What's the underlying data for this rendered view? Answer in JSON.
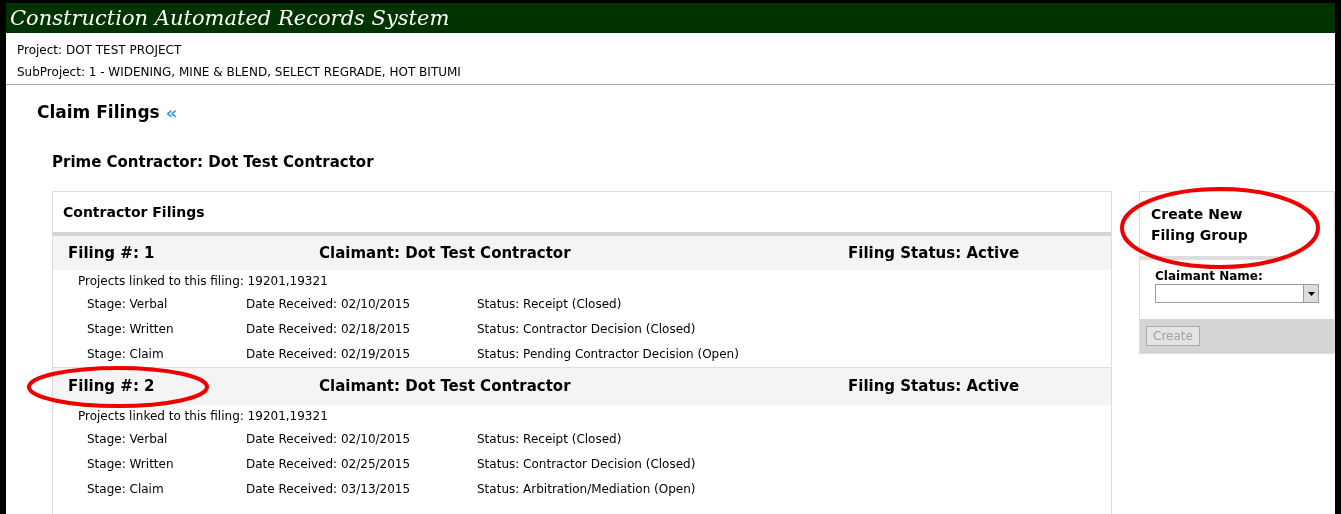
{
  "app_title": "Construction Automated Records System",
  "project": "Project: DOT TEST PROJECT",
  "subproject": "SubProject: 1 - WIDENING, MINE & BLEND, SELECT REGRADE, HOT BITUMI",
  "page_title": "Claim Filings",
  "collapse_glyph": "«",
  "prime_contractor": "Prime Contractor: Dot Test Contractor",
  "filings_panel": {
    "title": "Contractor Filings",
    "filings": [
      {
        "number": "Filing #: 1",
        "claimant": "Claimant: Dot Test Contractor",
        "status": "Filing Status: Active",
        "circled": false,
        "projects": "Projects linked to this filing: 19201,19321",
        "stages": [
          {
            "stage": "Stage: Verbal",
            "date": "Date Received: 02/10/2015",
            "status": "Status: Receipt (Closed)"
          },
          {
            "stage": "Stage: Written",
            "date": "Date Received: 02/18/2015",
            "status": "Status: Contractor Decision (Closed)"
          },
          {
            "stage": "Stage: Claim",
            "date": "Date Received: 02/19/2015",
            "status": "Status: Pending Contractor Decision (Open)"
          }
        ]
      },
      {
        "number": "Filing #: 2",
        "claimant": "Claimant: Dot Test Contractor",
        "status": "Filing Status: Active",
        "circled": true,
        "projects": "Projects linked to this filing: 19201,19321",
        "stages": [
          {
            "stage": "Stage: Verbal",
            "date": "Date Received: 02/10/2015",
            "status": "Status: Receipt (Closed)"
          },
          {
            "stage": "Stage: Written",
            "date": "Date Received: 02/25/2015",
            "status": "Status: Contractor Decision (Closed)"
          },
          {
            "stage": "Stage: Claim",
            "date": "Date Received: 03/13/2015",
            "status": "Status: Arbitration/Mediation (Open)"
          }
        ]
      }
    ]
  },
  "create_panel": {
    "title": "Create New Filing Group",
    "circled": true,
    "field_label": "Claimant Name:",
    "button": "Create",
    "button_disabled": true
  }
}
